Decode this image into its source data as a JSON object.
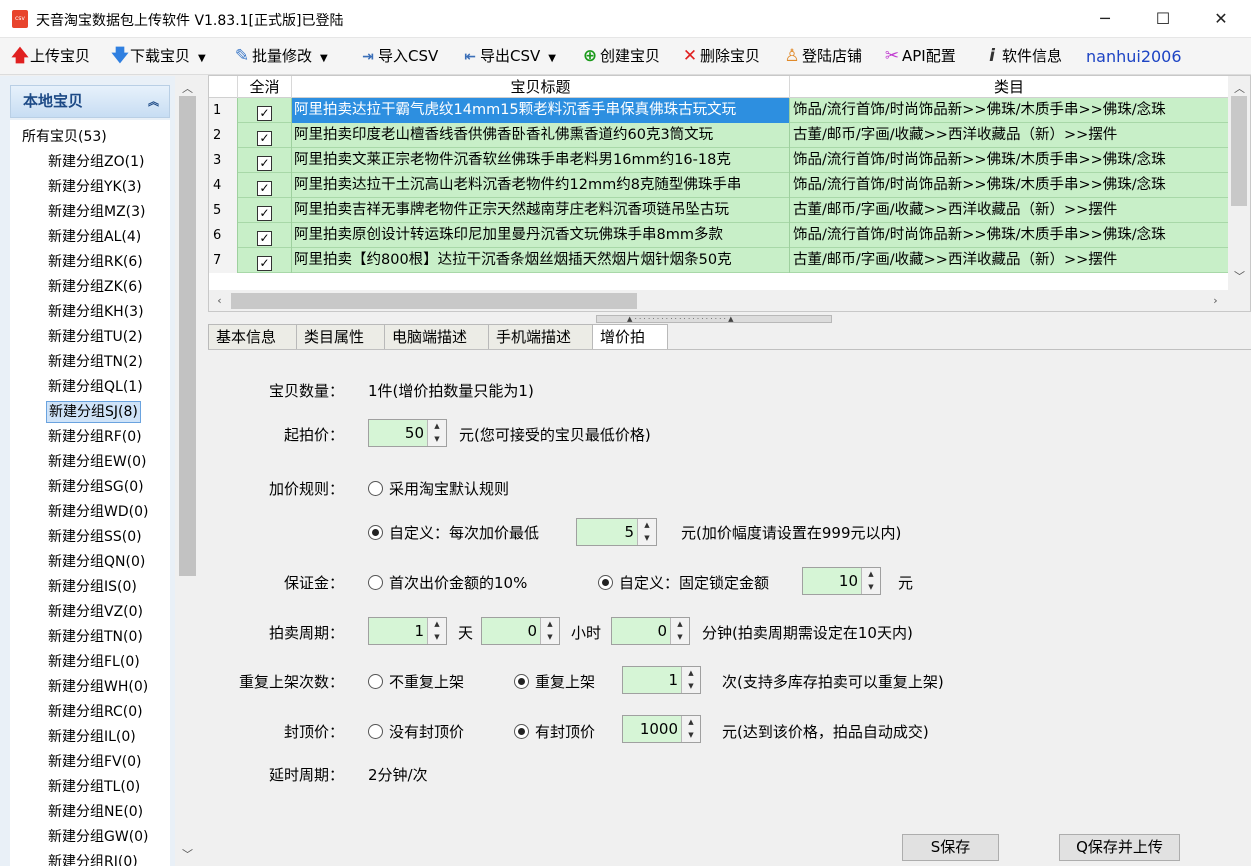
{
  "window": {
    "title": "天音淘宝数据包上传软件 V1.83.1[正式版]已登陆",
    "app_icon": "csv",
    "min": "─",
    "max": "☐",
    "close": "✕"
  },
  "toolbar": {
    "upload": "上传宝贝",
    "download": "下载宝贝",
    "batch_edit": "批量修改",
    "import_csv": "导入CSV",
    "export_csv": "导出CSV",
    "create": "创建宝贝",
    "delete": "删除宝贝",
    "login_shop": "登陆店铺",
    "api_config": "API配置",
    "software_info": "软件信息",
    "user": "nanhui2006"
  },
  "sidebar": {
    "header": "本地宝贝",
    "collapse": "«",
    "root": "所有宝贝(53)",
    "groups": [
      "新建分组ZO(1)",
      "新建分组YK(3)",
      "新建分组MZ(3)",
      "新建分组AL(4)",
      "新建分组RK(6)",
      "新建分组ZK(6)",
      "新建分组KH(3)",
      "新建分组TU(2)",
      "新建分组TN(2)",
      "新建分组QL(1)",
      "新建分组SJ(8)",
      "新建分组RF(0)",
      "新建分组EW(0)",
      "新建分组SG(0)",
      "新建分组WD(0)",
      "新建分组SS(0)",
      "新建分组QN(0)",
      "新建分组IS(0)",
      "新建分组VZ(0)",
      "新建分组TN(0)",
      "新建分组FL(0)",
      "新建分组WH(0)",
      "新建分组RC(0)",
      "新建分组IL(0)",
      "新建分组FV(0)",
      "新建分组TL(0)",
      "新建分组NE(0)",
      "新建分组GW(0)",
      "新建分组RI(0)"
    ],
    "selected_index": 10
  },
  "grid": {
    "headers": {
      "check_all": "全消",
      "title": "宝贝标题",
      "category": "类目"
    },
    "rows": [
      {
        "num": "1",
        "title": "阿里拍卖达拉干霸气虎纹14mm15颗老料沉香手串保真佛珠古玩文玩",
        "category": "饰品/流行首饰/时尚饰品新>>佛珠/木质手串>>佛珠/念珠"
      },
      {
        "num": "2",
        "title": "阿里拍卖印度老山檀香线香供佛香卧香礼佛熏香道约60克3筒文玩",
        "category": "古董/邮币/字画/收藏>>西洋收藏品（新）>>摆件"
      },
      {
        "num": "3",
        "title": "阿里拍卖文莱正宗老物件沉香软丝佛珠手串老料男16mm约16-18克",
        "category": "饰品/流行首饰/时尚饰品新>>佛珠/木质手串>>佛珠/念珠"
      },
      {
        "num": "4",
        "title": "阿里拍卖达拉干土沉高山老料沉香老物件约12mm约8克随型佛珠手串",
        "category": "饰品/流行首饰/时尚饰品新>>佛珠/木质手串>>佛珠/念珠"
      },
      {
        "num": "5",
        "title": "阿里拍卖吉祥无事牌老物件正宗天然越南芽庄老料沉香项链吊坠古玩",
        "category": "古董/邮币/字画/收藏>>西洋收藏品（新）>>摆件"
      },
      {
        "num": "6",
        "title": "阿里拍卖原创设计转运珠印尼加里曼丹沉香文玩佛珠手串8mm多款",
        "category": "饰品/流行首饰/时尚饰品新>>佛珠/木质手串>>佛珠/念珠"
      },
      {
        "num": "7",
        "title": "阿里拍卖【约800根】达拉干沉香条烟丝烟插天然烟片烟针烟条50克",
        "category": "古董/邮币/字画/收藏>>西洋收藏品（新）>>摆件"
      }
    ]
  },
  "tabs": [
    "基本信息",
    "类目属性",
    "电脑端描述",
    "手机端描述",
    "增价拍"
  ],
  "form": {
    "qty_label": "宝贝数量：",
    "qty_value": "1件(增价拍数量只能为1)",
    "start_label": "起拍价：",
    "start_value": "50",
    "start_hint": "元(您可接受的宝贝最低价格)",
    "rule_label": "加价规则：",
    "rule_default": "采用淘宝默认规则",
    "rule_custom": "自定义：每次加价最低",
    "rule_value": "5",
    "rule_hint": "元(加价幅度请设置在999元以内)",
    "deposit_label": "保证金：",
    "deposit_opt1": "首次出价金额的10%",
    "deposit_opt2": "自定义：固定锁定金额",
    "deposit_value": "10",
    "deposit_unit": "元",
    "period_label": "拍卖周期：",
    "period_days": "1",
    "unit_day": "天",
    "period_hours": "0",
    "unit_hour": "小时",
    "period_minutes": "0",
    "period_hint": "分钟(拍卖周期需设定在10天内)",
    "relist_label": "重复上架次数：",
    "relist_no": "不重复上架",
    "relist_yes": "重复上架",
    "relist_value": "1",
    "relist_hint": "次(支持多库存拍卖可以重复上架)",
    "cap_label": "封顶价：",
    "cap_no": "没有封顶价",
    "cap_yes": "有封顶价",
    "cap_value": "1000",
    "cap_hint": "元(达到该价格，拍品自动成交)",
    "delay_label": "延时周期：",
    "delay_value": "2分钟/次"
  },
  "buttons": {
    "save": "S保存",
    "save_upload": "Q保存并上传"
  }
}
